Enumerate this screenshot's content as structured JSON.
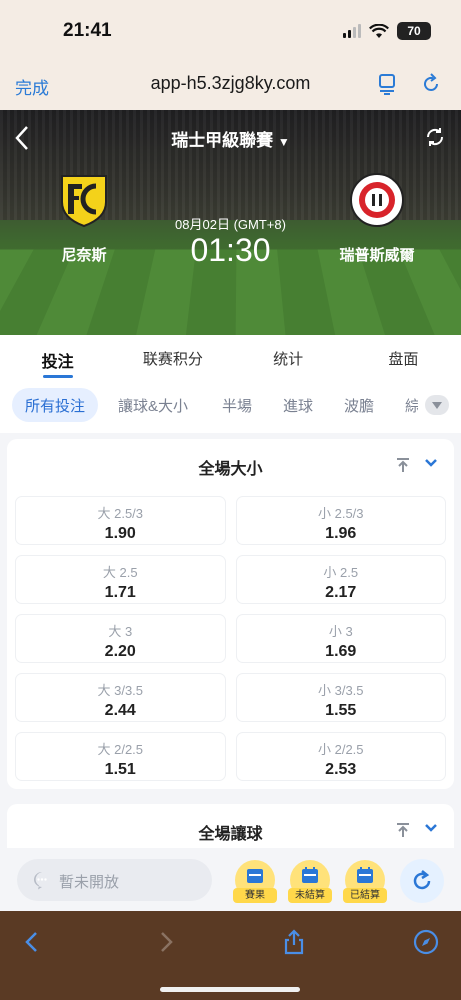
{
  "status": {
    "time": "21:41",
    "battery": "70"
  },
  "browser": {
    "done_label": "完成",
    "url": "app-h5.3zjg8ky.com"
  },
  "match": {
    "league": "瑞士甲級聯賽",
    "date": "08月02日 (GMT+8)",
    "time": "01:30",
    "home": "尼奈斯",
    "away": "瑞普斯威爾"
  },
  "tabs": [
    "投注",
    "联赛积分",
    "统计",
    "盘面"
  ],
  "filters": [
    "所有投注",
    "讓球&大小",
    "半場",
    "進球",
    "波膽",
    "綜"
  ],
  "markets": [
    {
      "title": "全場大小",
      "odds": [
        {
          "label": "大 2.5/3",
          "value": "1.90"
        },
        {
          "label": "小 2.5/3",
          "value": "1.96"
        },
        {
          "label": "大 2.5",
          "value": "1.71"
        },
        {
          "label": "小 2.5",
          "value": "2.17"
        },
        {
          "label": "大 3",
          "value": "2.20"
        },
        {
          "label": "小 3",
          "value": "1.69"
        },
        {
          "label": "大 3/3.5",
          "value": "2.44"
        },
        {
          "label": "小 3/3.5",
          "value": "1.55"
        },
        {
          "label": "大 2/2.5",
          "value": "1.51"
        },
        {
          "label": "小 2/2.5",
          "value": "2.53"
        }
      ]
    },
    {
      "title": "全場讓球"
    }
  ],
  "actions": {
    "comment_placeholder": "暫未開放",
    "results": "賽果",
    "unsettled": "未結算",
    "settled": "已結算"
  },
  "colors": {
    "accent": "#2a77d6",
    "browser_tint": "#5a3a24"
  }
}
